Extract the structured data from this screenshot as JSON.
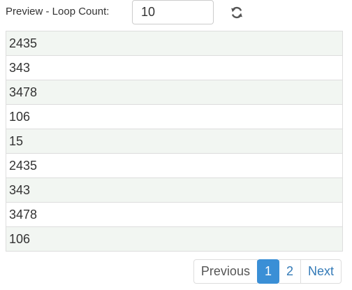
{
  "header": {
    "loop_label": "Preview - Loop Count:",
    "loop_value": "10",
    "refresh_icon": "refresh-icon"
  },
  "table": {
    "rows": [
      "2435",
      "343",
      "3478",
      "106",
      "15",
      "2435",
      "343",
      "3478",
      "106"
    ]
  },
  "pagination": {
    "previous_label": "Previous",
    "pages": [
      "1",
      "2"
    ],
    "active_page": "1",
    "next_label": "Next"
  },
  "colors": {
    "active_page_bg": "#3a8fd6",
    "link": "#337ab7",
    "striped_row": "#f2f6f2"
  }
}
